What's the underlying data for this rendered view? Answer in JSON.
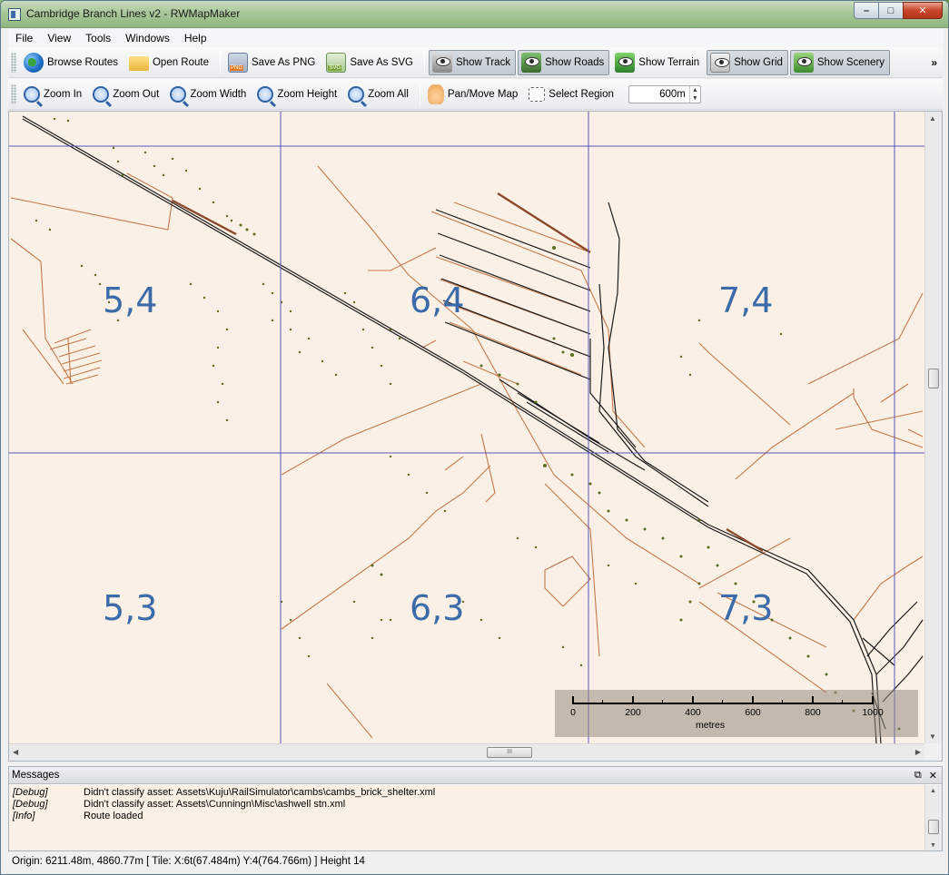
{
  "window": {
    "title": "Cambridge Branch Lines v2 - RWMapMaker",
    "minimize_glyph": "–",
    "maximize_glyph": "□",
    "close_glyph": "✕"
  },
  "menubar": {
    "items": [
      "File",
      "View",
      "Tools",
      "Windows",
      "Help"
    ]
  },
  "toolbar_main": {
    "browse_routes": "Browse Routes",
    "open_route": "Open Route",
    "save_png": "Save As PNG",
    "save_svg": "Save As SVG",
    "show_track": "Show Track",
    "show_roads": "Show Roads",
    "show_terrain": "Show Terrain",
    "show_grid": "Show Grid",
    "show_scenery": "Show Scenery",
    "overflow": "»",
    "icons": {
      "browse_routes": "globe-icon",
      "open_route": "folder-icon",
      "save_png": "png-file-icon",
      "save_svg": "svg-file-icon",
      "show_track": "eye-track-icon",
      "show_roads": "eye-road-icon",
      "show_terrain": "eye-terrain-icon",
      "show_grid": "eye-grid-icon",
      "show_scenery": "eye-scenery-icon"
    }
  },
  "toolbar_view": {
    "zoom_in": "Zoom In",
    "zoom_out": "Zoom Out",
    "zoom_width": "Zoom Width",
    "zoom_height": "Zoom Height",
    "zoom_all": "Zoom All",
    "pan_move": "Pan/Move Map",
    "select_region": "Select Region",
    "region_size": "600m",
    "spin_up": "▲",
    "spin_down": "▼"
  },
  "map": {
    "tiles": [
      "5,4",
      "6,4",
      "7,4",
      "5,3",
      "6,3",
      "7,3"
    ],
    "scale": {
      "ticks": [
        "0",
        "200",
        "400",
        "600",
        "800",
        "1000"
      ],
      "unit": "metres"
    },
    "colors": {
      "background": "#fbf0e6",
      "road": "#c47a4c",
      "track": "#1a1a1a",
      "grid": "#5a55c0",
      "scenery": "#5b6b1e",
      "label": "#3b6ba8"
    },
    "hscroll_grip": "III"
  },
  "messages": {
    "title": "Messages",
    "float_glyph": "⧉",
    "close_glyph": "✕",
    "rows": [
      {
        "level": "[Debug]",
        "text": "Didn't classify asset: Assets\\Kuju\\RailSimulator\\cambs\\cambs_brick_shelter.xml"
      },
      {
        "level": "[Debug]",
        "text": "Didn't classify asset: Assets\\Cunningn\\Misc\\ashwell stn.xml"
      },
      {
        "level": "[Info]",
        "text": "Route loaded"
      }
    ]
  },
  "status": {
    "text": "Origin: 6211.48m, 4860.77m [ Tile: X:6t(67.484m)  Y:4(764.766m) ]  Height 14"
  }
}
